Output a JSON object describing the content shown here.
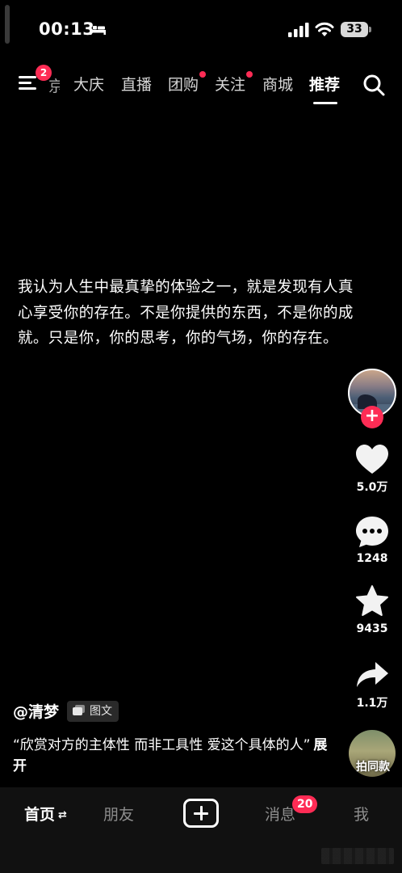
{
  "status_bar": {
    "time": "00:13",
    "battery": "33"
  },
  "top_nav": {
    "menu_badge": "2",
    "cut_tab": "京",
    "tabs": [
      {
        "label": "大庆"
      },
      {
        "label": "直播"
      },
      {
        "label": "团购"
      },
      {
        "label": "关注"
      },
      {
        "label": "商城"
      },
      {
        "label": "推荐"
      }
    ],
    "active_tab": "推荐"
  },
  "post": {
    "text": "我认为人生中最真挚的体验之一，就是发现有人真心享受你的存在。不是你提供的东西，不是你的成就。只是你，你的思考，你的气场，你的存在。",
    "author": "@清梦",
    "type_tag": "图文",
    "caption": "“欣赏对方的主体性 而非工具性 爱这个具体的人”",
    "expand_label": "展开"
  },
  "actions": {
    "likes": "5.0万",
    "comments": "1248",
    "favorites": "9435",
    "shares": "1.1万",
    "follow": "+",
    "sound_label": "拍同款"
  },
  "tab_bar": {
    "home": "首页",
    "home_switch": "⇄",
    "friends": "朋友",
    "messages": "消息",
    "messages_badge": "20",
    "me": "我"
  },
  "colors": {
    "accent": "#fe2c55",
    "background": "#000000"
  }
}
